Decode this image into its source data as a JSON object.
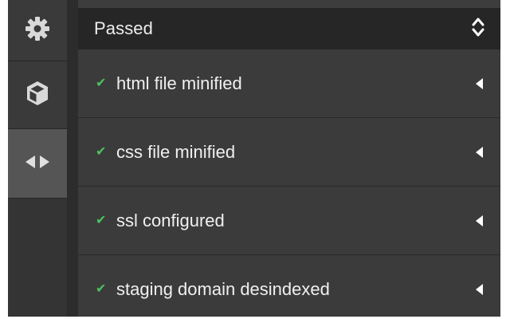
{
  "sidebar": {
    "items": [
      {
        "icon": "gear-icon"
      },
      {
        "icon": "cube-icon"
      },
      {
        "icon": "code-arrows-icon",
        "active": true
      }
    ]
  },
  "panel": {
    "header_title": "Passed",
    "sort_icon": "sort-updown-icon",
    "items": [
      {
        "label": "html file minified",
        "status": "passed"
      },
      {
        "label": "css file minified",
        "status": "passed"
      },
      {
        "label": "ssl configured",
        "status": "passed"
      },
      {
        "label": "staging domain desindexed",
        "status": "passed"
      }
    ]
  },
  "colors": {
    "check_green": "#4cc261",
    "header_bg": "#262626",
    "row_bg": "#3b3b3b",
    "rail_active_bg": "#555555"
  }
}
